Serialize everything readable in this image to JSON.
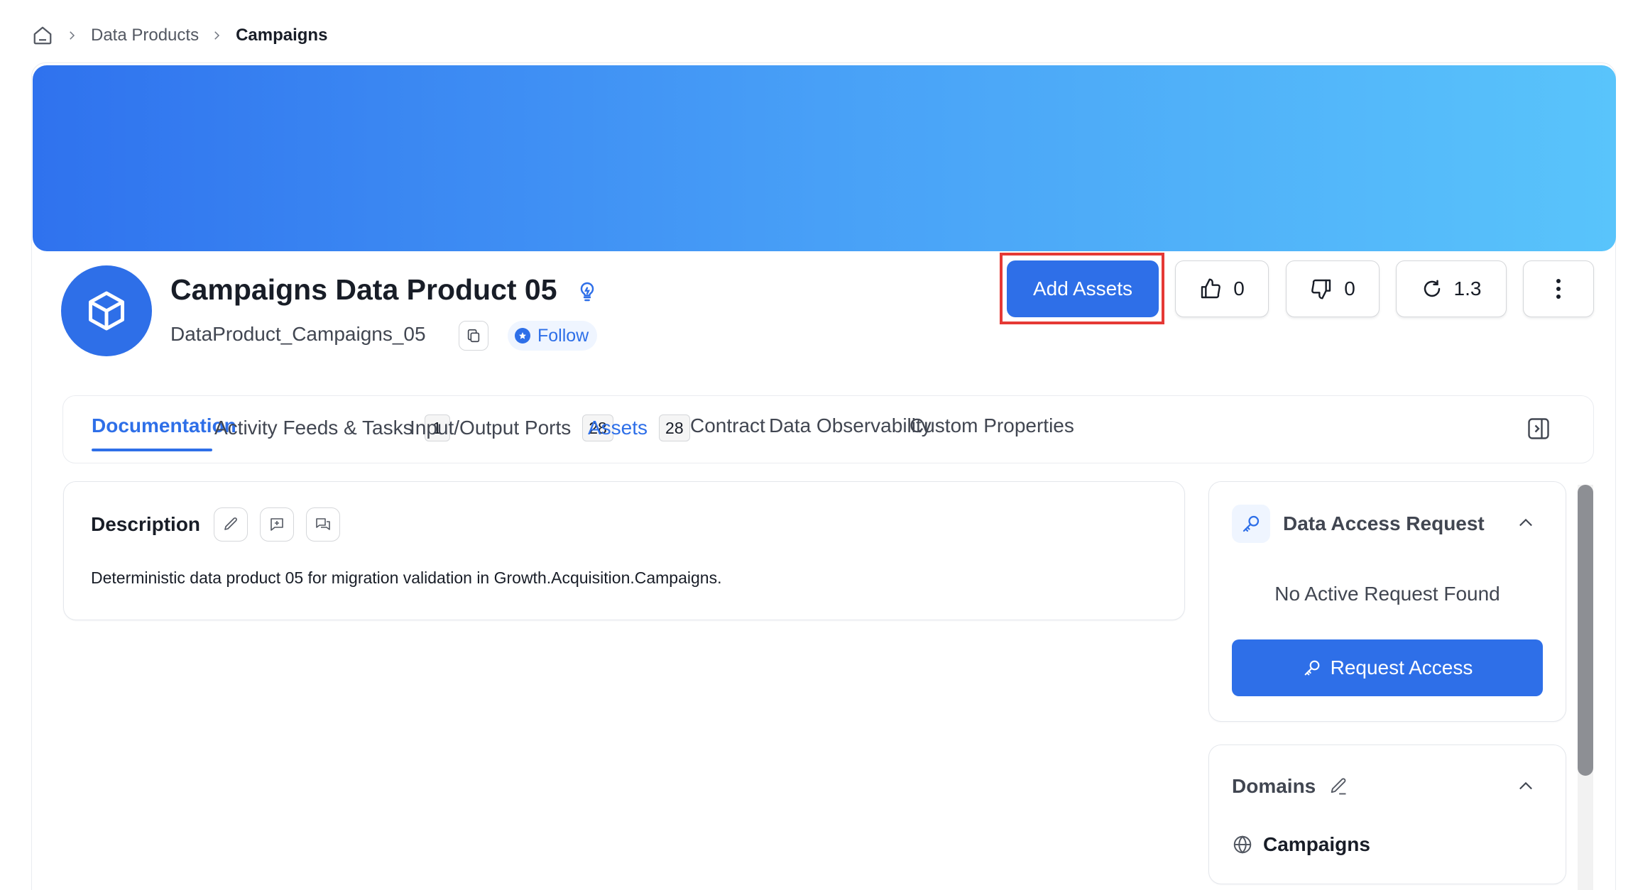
{
  "breadcrumb": {
    "items": [
      "Data Products",
      "Campaigns"
    ]
  },
  "header": {
    "title": "Campaigns Data Product 05",
    "fqn": "DataProduct_Campaigns_05",
    "follow_label": "Follow",
    "add_assets_label": "Add Assets",
    "likes": "0",
    "dislikes": "0",
    "version": "1.3"
  },
  "tabs": [
    {
      "label": "Documentation",
      "active": true
    },
    {
      "label": "Activity Feeds & Tasks",
      "count": "1"
    },
    {
      "label": "Input/Output Ports",
      "count": "28"
    },
    {
      "label": "Assets",
      "count": "28"
    },
    {
      "label": "Contract"
    },
    {
      "label": "Data Observability"
    },
    {
      "label": "Custom Properties"
    }
  ],
  "description": {
    "title": "Description",
    "text": "Deterministic data product 05 for migration validation in Growth.Acquisition.Campaigns."
  },
  "data_access": {
    "title": "Data Access Request",
    "empty_text": "No Active Request Found",
    "button_label": "Request Access"
  },
  "domains": {
    "title": "Domains",
    "items": [
      "Campaigns"
    ]
  },
  "colors": {
    "primary": "#2e6fe8",
    "highlight": "#e53935",
    "banner_start": "#2f72ee",
    "banner_end": "#59c4fb"
  }
}
